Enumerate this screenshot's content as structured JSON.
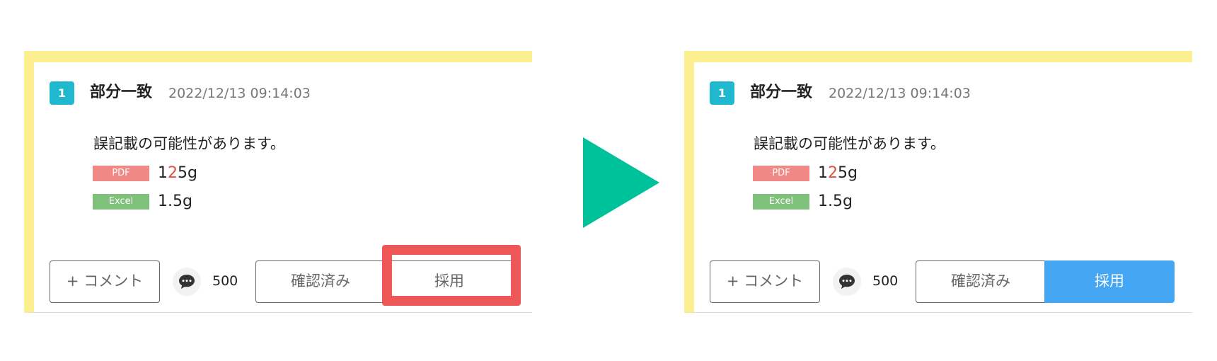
{
  "before": {
    "badge_number": "1",
    "match_status": "部分一致",
    "timestamp": "2022/12/13 09:14:03",
    "message": "誤記載の可能性があります。",
    "sources": [
      {
        "tag": "PDF",
        "value_prefix": "1",
        "value_diff": "2",
        "value_suffix": "5g",
        "tag_color": "#f08886"
      },
      {
        "tag": "Excel",
        "value": "1.5g",
        "tag_color": "#7fc07a"
      }
    ],
    "add_comment_label": "+ コメント",
    "comment_icon": "speech-bubble-icon",
    "comment_count": "500",
    "confirmed_label": "確認済み",
    "adopt_label": "採用",
    "adopt_active": false,
    "highlight_color": "#ee5757"
  },
  "after": {
    "badge_number": "1",
    "match_status": "部分一致",
    "timestamp": "2022/12/13 09:14:03",
    "message": "誤記載の可能性があります。",
    "sources": [
      {
        "tag": "PDF",
        "value_prefix": "1",
        "value_diff": "2",
        "value_suffix": "5g",
        "tag_color": "#f08886"
      },
      {
        "tag": "Excel",
        "value": "1.5g",
        "tag_color": "#7fc07a"
      }
    ],
    "add_comment_label": "+ コメント",
    "comment_icon": "speech-bubble-icon",
    "comment_count": "500",
    "confirmed_label": "確認済み",
    "adopt_label": "採用",
    "adopt_active": true,
    "active_color": "#45a6f3"
  },
  "colors": {
    "panel_accent": "#fbee8e",
    "badge": "#1fb8cf",
    "arrow": "#00c29a"
  },
  "arrow_icon": "play-arrow-icon"
}
